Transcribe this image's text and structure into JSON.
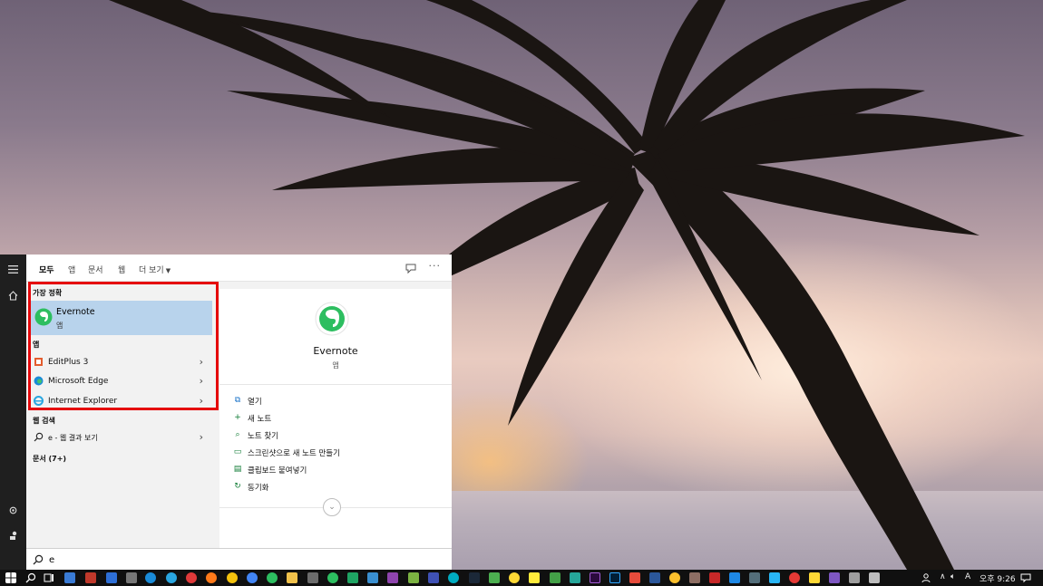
{
  "panel": {
    "tabs": [
      "모두",
      "앱",
      "문서",
      "웹",
      "더 보기"
    ],
    "more_icon": "ellipsis-icon",
    "feedback_icon": "feedback-icon"
  },
  "results": {
    "best_match_title": "가장 정확",
    "best_match": {
      "name": "Evernote",
      "type": "앱"
    },
    "apps_title": "앱",
    "apps": [
      {
        "name": "EditPlus 3"
      },
      {
        "name": "Microsoft Edge"
      },
      {
        "name": "Internet Explorer"
      }
    ],
    "web_title": "웹 검색",
    "web_query": "e - 웹 결과 보기",
    "docs_title": "문서 (7+)"
  },
  "detail": {
    "name": "Evernote",
    "type": "앱",
    "actions": [
      {
        "label": "열기",
        "icon": "open-icon"
      },
      {
        "label": "새 노트",
        "icon": "plus-icon"
      },
      {
        "label": "노트 찾기",
        "icon": "search-icon"
      },
      {
        "label": "스크린샷으로 새 노트 만들기",
        "icon": "screenshot-icon"
      },
      {
        "label": "클립보드 붙여넣기",
        "icon": "clipboard-icon"
      },
      {
        "label": "동기화",
        "icon": "sync-icon"
      }
    ]
  },
  "search": {
    "value": "e"
  },
  "taskbar": {
    "ime": "A",
    "time": "오후 9:26"
  },
  "colors": {
    "accent": "#0063b1",
    "selection": "#b8d3ec",
    "highlight_box": "#e5070a",
    "evernote_green": "#2dbe60"
  }
}
